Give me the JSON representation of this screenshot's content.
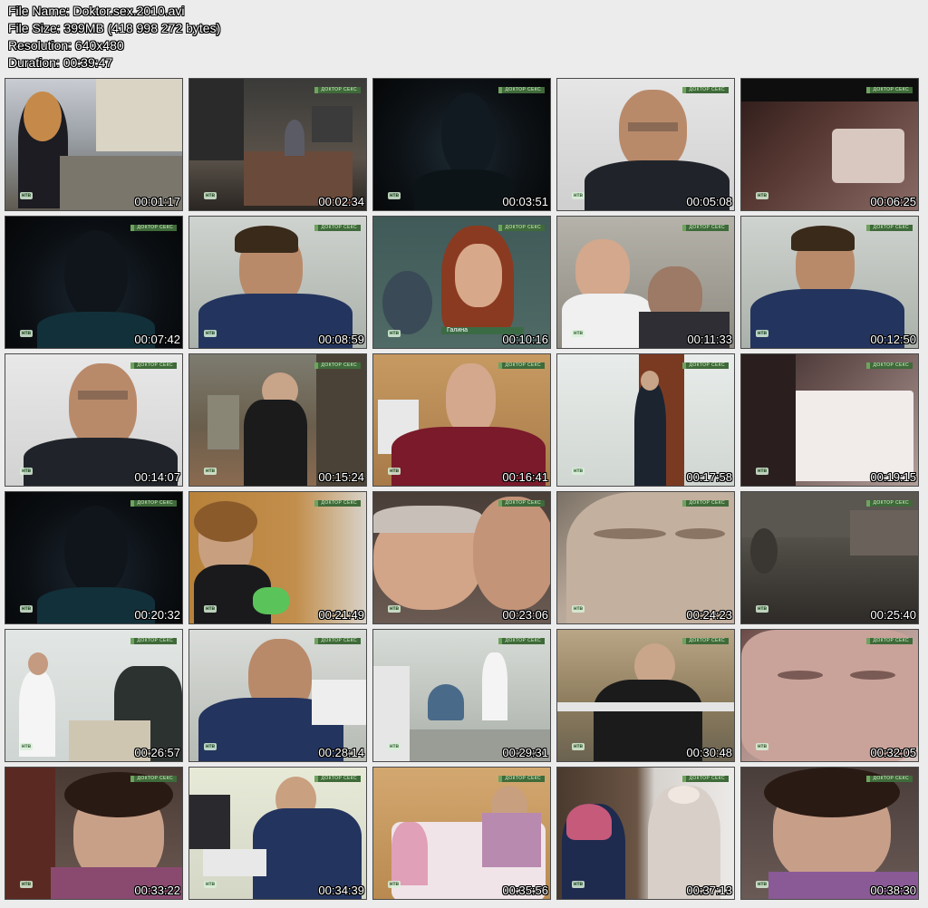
{
  "file_info": {
    "file_name": "File Name: Doktor.sex.2010.avi",
    "file_size": "File Size: 399MB (418 998 272 bytes)",
    "resolution": "Resolution: 640x480",
    "duration": "Duration: 00:39:47"
  },
  "overlay": {
    "show_title": "ДОКТОР СЕКС",
    "channel_logo": "нтв",
    "caption_name": "Галина"
  },
  "thumbnails": [
    {
      "time": "00:01:17"
    },
    {
      "time": "00:02:34"
    },
    {
      "time": "00:03:51"
    },
    {
      "time": "00:05:08"
    },
    {
      "time": "00:06:25"
    },
    {
      "time": "00:07:42"
    },
    {
      "time": "00:08:59"
    },
    {
      "time": "00:10:16"
    },
    {
      "time": "00:11:33"
    },
    {
      "time": "00:12:50"
    },
    {
      "time": "00:14:07"
    },
    {
      "time": "00:15:24"
    },
    {
      "time": "00:16:41"
    },
    {
      "time": "00:17:58"
    },
    {
      "time": "00:19:15"
    },
    {
      "time": "00:20:32"
    },
    {
      "time": "00:21:49"
    },
    {
      "time": "00:23:06"
    },
    {
      "time": "00:24:23"
    },
    {
      "time": "00:25:40"
    },
    {
      "time": "00:26:57"
    },
    {
      "time": "00:28:14"
    },
    {
      "time": "00:29:31"
    },
    {
      "time": "00:30:48"
    },
    {
      "time": "00:32:05"
    },
    {
      "time": "00:33:22"
    },
    {
      "time": "00:34:39"
    },
    {
      "time": "00:35:56"
    },
    {
      "time": "00:37:13"
    },
    {
      "time": "00:38:30"
    }
  ]
}
